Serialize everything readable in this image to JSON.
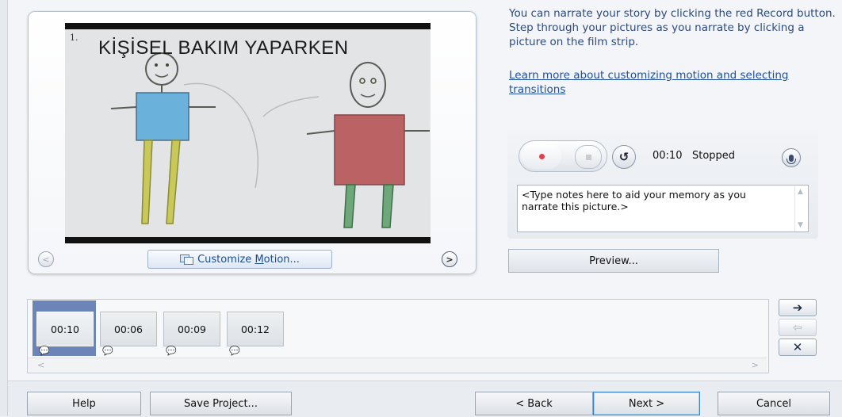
{
  "preview": {
    "picture_number": "1.",
    "picture_title": "KİŞİSEL BAKIM YAPARKEN",
    "customize_label": "Customize ",
    "customize_accel": "M",
    "customize_rest": "otion...",
    "prev_icon": "chevron-left-icon",
    "next_icon": "chevron-right-icon"
  },
  "info": {
    "instructions": "You can narrate your story by clicking the red Record button. Step through your pictures as you narrate by clicking a picture on the film strip.",
    "learn_more_link": "Learn more about customizing motion and selecting transitions"
  },
  "narration": {
    "time": "00:10",
    "status": "Stopped",
    "notes_placeholder": "<Type notes here to aid your memory as you narrate this picture.>",
    "record_color": "#e04050"
  },
  "preview_button": "Preview...",
  "filmstrip": {
    "items": [
      {
        "duration": "00:10",
        "selected": true
      },
      {
        "duration": "00:06",
        "selected": false
      },
      {
        "duration": "00:09",
        "selected": false
      },
      {
        "duration": "00:12",
        "selected": false
      }
    ],
    "scroll_left": "<",
    "scroll_right": ">"
  },
  "side_buttons": {
    "move_right": "➔",
    "move_left": "⇦",
    "remove": "✕"
  },
  "footer": {
    "help": "Help",
    "save_project": "Save Project...",
    "back": "< Back",
    "next": "Next >",
    "cancel": "Cancel"
  }
}
